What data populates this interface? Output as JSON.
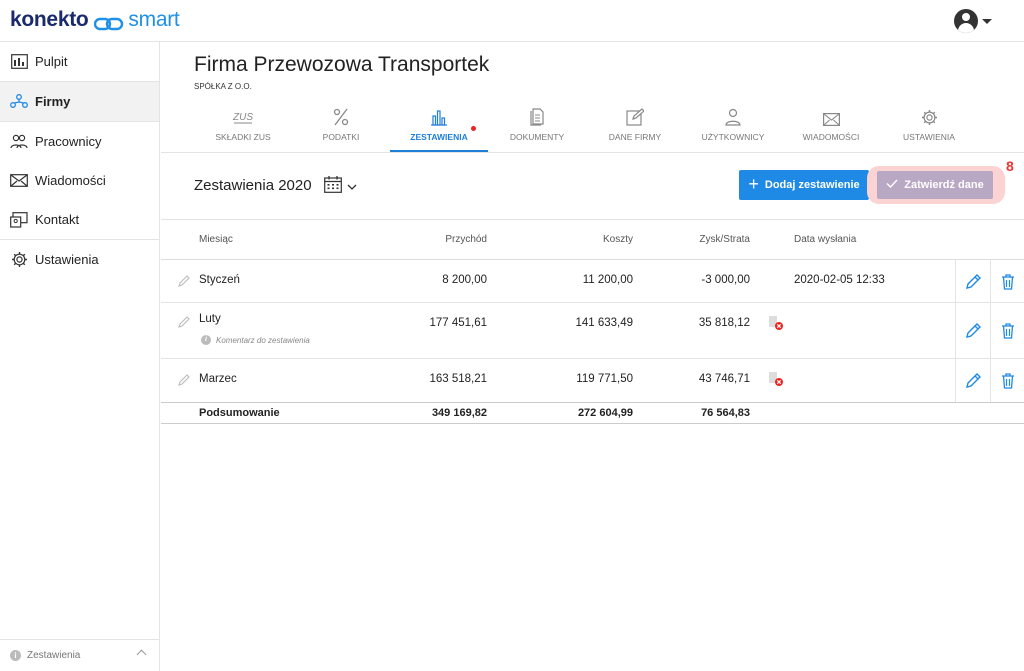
{
  "brand": {
    "name": "konekto",
    "suffix": "smart"
  },
  "sidebar": {
    "items": [
      {
        "label": "Pulpit",
        "icon": "dashboard-icon"
      },
      {
        "label": "Firmy",
        "icon": "companies-icon",
        "active": true
      },
      {
        "label": "Pracownicy",
        "icon": "employees-icon"
      },
      {
        "label": "Wiadomości",
        "icon": "mail-icon"
      },
      {
        "label": "Kontakt",
        "icon": "contact-icon"
      },
      {
        "label": "Ustawienia",
        "icon": "gear-icon"
      }
    ],
    "footer_label": "Zestawienia"
  },
  "company": {
    "name": "Firma Przewozowa Transportek",
    "type": "SPÓŁKA Z O.O."
  },
  "tabs": [
    {
      "label": "SKŁADKI ZUS",
      "icon": "zus-icon"
    },
    {
      "label": "PODATKI",
      "icon": "percent-icon"
    },
    {
      "label": "ZESTAWIENIA",
      "icon": "bar-chart-icon",
      "active": true
    },
    {
      "label": "DOKUMENTY",
      "icon": "document-icon"
    },
    {
      "label": "DANE FIRMY",
      "icon": "edit-icon"
    },
    {
      "label": "UŻYTKOWNICY",
      "icon": "user-icon"
    },
    {
      "label": "WIADOMOŚCI",
      "icon": "mail-icon"
    },
    {
      "label": "USTAWIENIA",
      "icon": "gear-icon"
    }
  ],
  "section": {
    "title": "Zestawienia 2020",
    "add_label": "Dodaj zestawienie",
    "confirm_label": "Zatwierdź dane",
    "confirm_badge": "8"
  },
  "table": {
    "headers": {
      "month": "Miesiąc",
      "income": "Przychód",
      "costs": "Koszty",
      "profit": "Zysk/Strata",
      "sent": "Data wysłania"
    },
    "rows": [
      {
        "month": "Styczeń",
        "income": "8 200,00",
        "costs": "11 200,00",
        "profit": "-3 000,00",
        "sent": "2020-02-05 12:33",
        "comment": ""
      },
      {
        "month": "Luty",
        "income": "177 451,61",
        "costs": "141 633,49",
        "profit": "35 818,12",
        "sent": "",
        "comment": "Komentarz do zestawienia"
      },
      {
        "month": "Marzec",
        "income": "163 518,21",
        "costs": "119 771,50",
        "profit": "43 746,71",
        "sent": "",
        "comment": ""
      }
    ],
    "summary": {
      "label": "Podsumowanie",
      "income": "349 169,82",
      "costs": "272 604,99",
      "profit": "76 564,83"
    }
  },
  "colors": {
    "accent": "#1e8ae6",
    "danger": "#e22222",
    "brand": "#1a2a6c"
  }
}
